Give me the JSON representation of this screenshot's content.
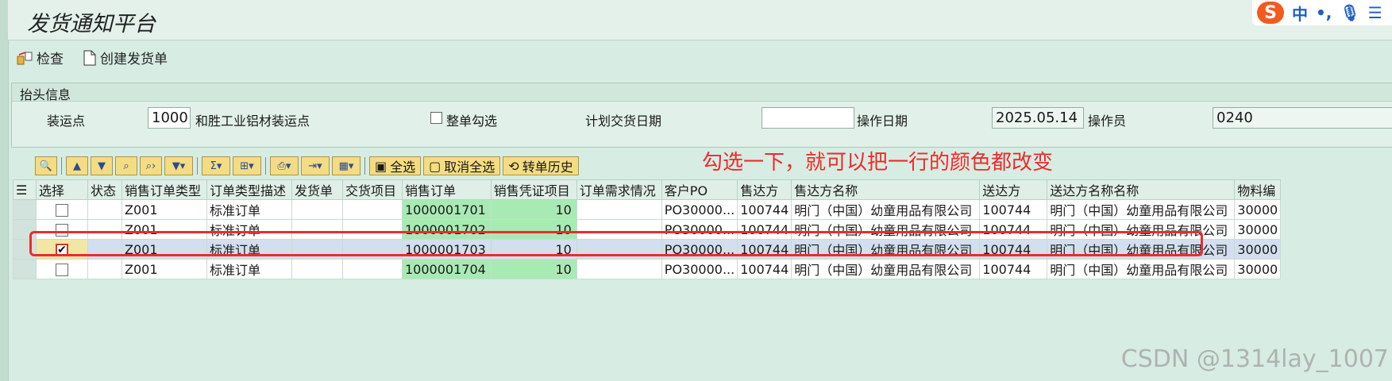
{
  "window": {
    "title": "发货通知平台"
  },
  "ime": {
    "logo": "S",
    "lang": "中",
    "punct": "•,",
    "mic": "🎙",
    "more": "☰"
  },
  "toolbar": {
    "check_label": "检查",
    "create_label": "创建发货单"
  },
  "header": {
    "caption": "抬头信息",
    "shipping_point_label": "装运点",
    "shipping_point_value": "1000",
    "shipping_point_desc": "和胜工业铝材装运点",
    "whole_order_label": "整单勾选",
    "planned_date_label": "计划交货日期",
    "planned_date_value": "",
    "op_date_label": "操作日期",
    "op_date_value": "2025.05.14",
    "operator_label": "操作员",
    "operator_value": "0240"
  },
  "alv_toolbar": {
    "select_all": "全选",
    "deselect_all": "取消全选",
    "history": "转单历史"
  },
  "annotation": "勾选一下，就可以把一行的颜色都改变",
  "table": {
    "columns": [
      "选择",
      "状态",
      "销售订单类型",
      "订单类型描述",
      "发货单",
      "交货项目",
      "销售订单",
      "销售凭证项目",
      "订单需求情况",
      "客户PO",
      "售达方",
      "售达方名称",
      "送达方",
      "送达方名称名称",
      "物料编"
    ],
    "rows": [
      {
        "checked": "",
        "status": "",
        "type": "Z001",
        "type_desc": "标准订单",
        "delivery": "",
        "delivery_item": "",
        "so": "1000001701",
        "item": "10",
        "demand": "",
        "po": "PO30000...",
        "sold_to": "100744",
        "sold_to_name": "明门（中国）幼童用品有限公司",
        "ship_to": "100744",
        "ship_to_name": "明门（中国）幼童用品有限公司",
        "material": "30000"
      },
      {
        "checked": "",
        "status": "",
        "type": "Z001",
        "type_desc": "标准订单",
        "delivery": "",
        "delivery_item": "",
        "so": "1000001702",
        "item": "10",
        "demand": "",
        "po": "PO30000...",
        "sold_to": "100744",
        "sold_to_name": "明门（中国）幼童用品有限公司",
        "ship_to": "100744",
        "ship_to_name": "明门（中国）幼童用品有限公司",
        "material": "30000"
      },
      {
        "checked": "✔",
        "status": "",
        "type": "Z001",
        "type_desc": "标准订单",
        "delivery": "",
        "delivery_item": "",
        "so": "1000001703",
        "item": "10",
        "demand": "",
        "po": "PO30000...",
        "sold_to": "100744",
        "sold_to_name": "明门（中国）幼童用品有限公司",
        "ship_to": "100744",
        "ship_to_name": "明门（中国）幼童用品有限公司",
        "material": "30000"
      },
      {
        "checked": "",
        "status": "",
        "type": "Z001",
        "type_desc": "标准订单",
        "delivery": "",
        "delivery_item": "",
        "so": "1000001704",
        "item": "10",
        "demand": "",
        "po": "PO30000...",
        "sold_to": "100744",
        "sold_to_name": "明门（中国）幼童用品有限公司",
        "ship_to": "100744",
        "ship_to_name": "明门（中国）幼童用品有限公司",
        "material": "30000"
      }
    ]
  },
  "watermark": "CSDN @1314lay_1007",
  "colors": {
    "highlight_row": "#d3dfee",
    "green_cell": "#a8eab4",
    "annotation": "#ec2b2b"
  }
}
